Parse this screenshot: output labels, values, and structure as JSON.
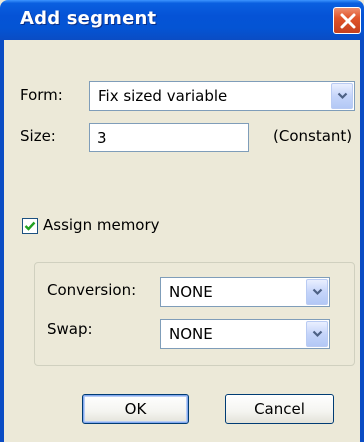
{
  "window": {
    "title": "Add segment",
    "close_icon": "close-icon"
  },
  "form": {
    "form_label": "Form:",
    "form_value": "Fix sized variable",
    "size_label": "Size:",
    "size_value": "3",
    "size_note": "(Constant)"
  },
  "memory": {
    "assign_label": "Assign memory",
    "assign_checked": true
  },
  "conversion_group": {
    "conversion_label": "Conversion:",
    "conversion_value": "NONE",
    "swap_label": "Swap:",
    "swap_value": "NONE"
  },
  "buttons": {
    "ok_label": "OK",
    "cancel_label": "Cancel"
  },
  "colors": {
    "titlebar": "#0553d6",
    "dialog_bg": "#ece9d8",
    "close_red": "#e0542a",
    "field_border": "#7f9db9"
  }
}
